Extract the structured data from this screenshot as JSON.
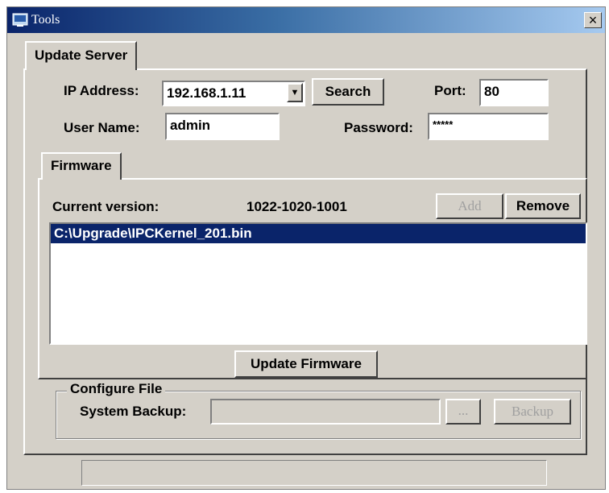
{
  "window": {
    "title": "Tools",
    "close_label": "×"
  },
  "tabs": {
    "update_server": "Update Server",
    "firmware": "Firmware"
  },
  "server": {
    "ip_label": "IP Address:",
    "ip_value": "192.168.1.11",
    "dropdown_arrow": "▼",
    "search_label": "Search",
    "port_label": "Port:",
    "port_value": "80",
    "username_label": "User Name:",
    "username_value": "admin",
    "password_label": "Password:",
    "password_value": "*****"
  },
  "firmware": {
    "current_version_label": "Current version:",
    "current_version_value": "1022-1020-1001",
    "add_label": "Add",
    "remove_label": "Remove",
    "files": [
      {
        "path": "C:\\Upgrade\\IPCKernel_201.bin",
        "selected": true
      }
    ],
    "update_label": "Update Firmware"
  },
  "configure": {
    "group_label": "Configure File",
    "backup_label": "System Backup:",
    "backup_path": "",
    "browse_label": "...",
    "backup_button": "Backup"
  },
  "status": {
    "text": ""
  },
  "colors": {
    "selection": "#0a246a",
    "face": "#d4d0c8"
  }
}
